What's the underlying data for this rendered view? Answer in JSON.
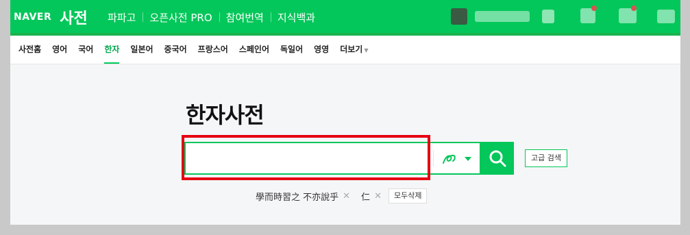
{
  "header": {
    "logo": "NAVER",
    "dict_title": "사전",
    "links": [
      "파파고",
      "오픈사전 PRO",
      "참여번역",
      "지식백과"
    ]
  },
  "nav": {
    "items": [
      "사전홈",
      "영어",
      "국어",
      "한자",
      "일본어",
      "중국어",
      "프랑스어",
      "스페인어",
      "독일어",
      "영영",
      "더보기"
    ],
    "active": "한자"
  },
  "main": {
    "title": "한자사전",
    "search": {
      "value": "",
      "placeholder": ""
    },
    "advanced_label": "고급 검색",
    "recent": [
      "學而時習之 不亦說乎",
      "仁"
    ],
    "clear_all_label": "모두삭제"
  },
  "colors": {
    "brand_green": "#03c75a",
    "highlight_red": "#e60012"
  }
}
